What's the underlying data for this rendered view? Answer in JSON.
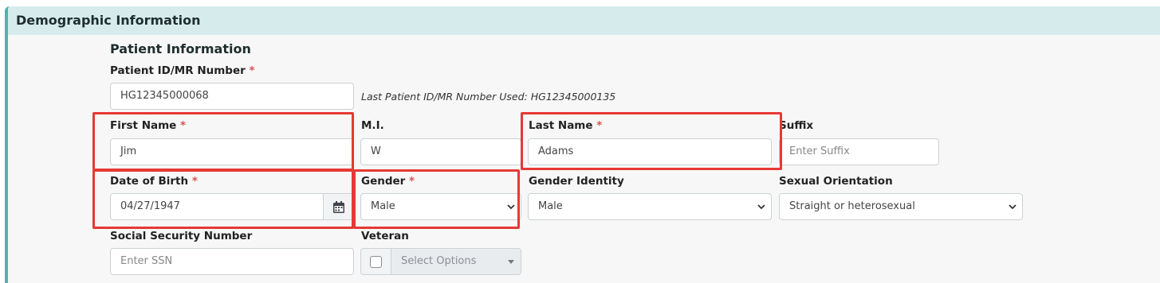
{
  "panel": {
    "title": "Demographic Information"
  },
  "section": {
    "title": "Patient Information"
  },
  "fields": {
    "patient_id": {
      "label": "Patient ID/MR Number",
      "required": "*",
      "value": "HG12345000068"
    },
    "last_used": "Last Patient ID/MR Number Used: HG12345000135",
    "first_name": {
      "label": "First Name",
      "required": "*",
      "value": "Jim"
    },
    "middle_initial": {
      "label": "M.I.",
      "value": "W"
    },
    "last_name": {
      "label": "Last Name",
      "required": "*",
      "value": "Adams"
    },
    "suffix": {
      "label": "Suffix",
      "placeholder": "Enter Suffix"
    },
    "dob": {
      "label": "Date of Birth",
      "required": "*",
      "value": "04/27/1947"
    },
    "gender": {
      "label": "Gender",
      "required": "*",
      "value": "Male"
    },
    "gender_identity": {
      "label": "Gender Identity",
      "value": "Male"
    },
    "sexual_orientation": {
      "label": "Sexual Orientation",
      "value": "Straight or heterosexual"
    },
    "ssn": {
      "label": "Social Security Number",
      "placeholder": "Enter SSN"
    },
    "veteran": {
      "label": "Veteran",
      "placeholder": "Select Options"
    }
  },
  "colors": {
    "accent": "#4fb3ad",
    "header_bg": "#d6ecec",
    "highlight": "#e53935",
    "required": "#d9534f"
  },
  "icons": {
    "calendar": "calendar-icon",
    "chevron": "chevron-down-icon"
  }
}
